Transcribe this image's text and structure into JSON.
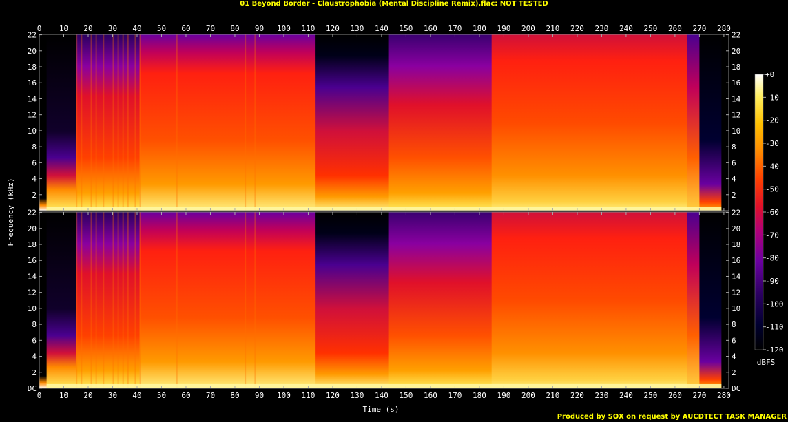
{
  "title": "01 Beyond Border - Claustrophobia (Mental Discipline Remix).flac: NOT TESTED",
  "footer": "Produced by SOX on request by AUCDTECT TASK MANAGER",
  "chart_data": {
    "type": "heatmap",
    "channels": 2,
    "xlabel": "Time (s)",
    "ylabel": "Frequency (kHz)",
    "colorbar_label": "dBFS",
    "x_ticks": [
      "0",
      "10",
      "20",
      "30",
      "40",
      "50",
      "60",
      "70",
      "80",
      "90",
      "100",
      "110",
      "120",
      "130",
      "140",
      "150",
      "160",
      "170",
      "180",
      "190",
      "200",
      "210",
      "220",
      "230",
      "240",
      "250",
      "260",
      "270",
      "280"
    ],
    "y_ticks_top": [
      "22",
      "20",
      "18",
      "16",
      "14",
      "12",
      "10",
      "8",
      "6",
      "4",
      "2"
    ],
    "y_ticks_bottom": [
      "22",
      "20",
      "18",
      "16",
      "14",
      "12",
      "10",
      "8",
      "6",
      "4",
      "2",
      "DC"
    ],
    "colorbar_ticks": [
      "+0",
      "-10",
      "-20",
      "-30",
      "-40",
      "-50",
      "-60",
      "-70",
      "-80",
      "-90",
      "-100",
      "-110",
      "-120"
    ],
    "xlim": [
      0,
      282
    ],
    "ylim_khz": [
      0,
      22.05
    ],
    "clim_dbfs": [
      -120,
      0
    ],
    "colormap": [
      "#000000",
      "#000030",
      "#2a0060",
      "#6a00a0",
      "#b0007a",
      "#e0102a",
      "#ff4000",
      "#ff8a00",
      "#ffc000",
      "#ffee60",
      "#ffffff"
    ]
  }
}
